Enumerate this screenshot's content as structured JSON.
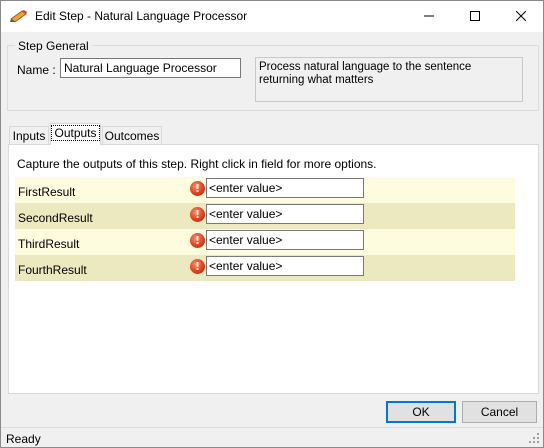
{
  "window": {
    "title": "Edit Step - Natural Language Processor",
    "icons": {
      "app": "pencil-icon",
      "minimize": "minimize-icon",
      "maximize": "maximize-icon",
      "close": "close-icon"
    }
  },
  "step_general": {
    "legend": "Step General",
    "name_label": "Name :",
    "name_value": "Natural Language Processor",
    "description": "Process natural language to the sentence returning what matters"
  },
  "tabs": [
    {
      "label": "Inputs",
      "selected": false
    },
    {
      "label": "Outputs",
      "selected": true
    },
    {
      "label": "Outcomes",
      "selected": false
    }
  ],
  "outputs": {
    "caption": "Capture the outputs of this step.  Right click in field for more options.",
    "rows": [
      {
        "label": "FirstResult",
        "value": "<enter value>",
        "icon": "error-icon"
      },
      {
        "label": "SecondResult",
        "value": "<enter value>",
        "icon": "error-icon"
      },
      {
        "label": "ThirdResult",
        "value": "<enter value>",
        "icon": "error-icon"
      },
      {
        "label": "FourthResult",
        "value": "<enter value>",
        "icon": "error-icon"
      }
    ]
  },
  "buttons": {
    "ok": "OK",
    "cancel": "Cancel"
  },
  "status": {
    "text": "Ready",
    "icon": "resize-grip-icon"
  },
  "colors": {
    "row_odd": "#fefcdf",
    "row_even": "#ece8c0",
    "error": "#e0401a",
    "accent": "#0078d7"
  }
}
